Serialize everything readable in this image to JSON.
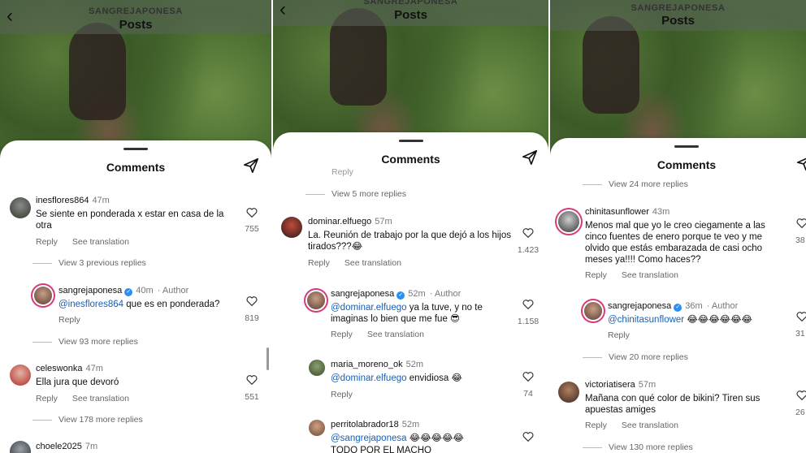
{
  "header": {
    "username": "SANGREJAPONESA",
    "title": "Posts"
  },
  "sheet_title": "Comments",
  "p1": {
    "c1": {
      "user": "inesflores864",
      "time": "47m",
      "text": "Se siente en ponderada x estar en casa de la otra",
      "reply": "Reply",
      "translate": "See translation",
      "likes": "755",
      "more": "View 3 previous replies"
    },
    "c2": {
      "user": "sangrejaponesa",
      "time": "40m",
      "author": "· Author",
      "mention": "@inesflores864",
      "text": " que es en ponderada?",
      "reply": "Reply",
      "likes": "819",
      "more": "View 93 more replies"
    },
    "c3": {
      "user": "celeswonka",
      "time": "47m",
      "text": "Ella jura que devoró",
      "reply": "Reply",
      "translate": "See translation",
      "likes": "551",
      "more": "View 178 more replies"
    },
    "c4": {
      "user": "choele2025",
      "time": "7m"
    }
  },
  "p2": {
    "top_reply": "Reply",
    "more_top": "View 5 more replies",
    "c1": {
      "user": "dominar.elfuego",
      "time": "57m",
      "text": "La. Reunión de trabajo por la que dejó a los hijos tirados???😂",
      "reply": "Reply",
      "translate": "See translation",
      "likes": "1.423"
    },
    "c2": {
      "user": "sangrejaponesa",
      "time": "52m",
      "author": "· Author",
      "mention": "@dominar.elfuego",
      "text": " ya la tuve, y no te imaginas lo bien que me fue 😎",
      "reply": "Reply",
      "translate": "See translation",
      "likes": "1.158"
    },
    "c3": {
      "user": "maria_moreno_ok",
      "time": "52m",
      "mention": "@dominar.elfuego",
      "text": " envidiosa 😂",
      "reply": "Reply",
      "likes": "74"
    },
    "c4": {
      "user": "perritolabrador18",
      "time": "52m",
      "mention": "@sangrejaponesa",
      "text": " 😂😂😂😂😂",
      "text2": "TODO POR EL MACHO"
    }
  },
  "p3": {
    "more_top": "View 24 more replies",
    "c1": {
      "user": "chinitasunflower",
      "time": "43m",
      "text": "Menos mal que yo le creo ciegamente a las cinco fuentes de enero porque te veo y me olvido que estás embarazada de casi ocho meses ya!!!! Como haces??",
      "reply": "Reply",
      "translate": "See translation",
      "likes": "38"
    },
    "c2": {
      "user": "sangrejaponesa",
      "time": "36m",
      "author": "· Author",
      "mention": "@chinitasunflower",
      "text": " 😂😂😂😂😂😂",
      "reply": "Reply",
      "likes": "31",
      "more": "View 20 more replies"
    },
    "c3": {
      "user": "victoriatisera",
      "time": "57m",
      "text": "Mañana con qué color de bikini? Tiren sus apuestas amiges",
      "reply": "Reply",
      "translate": "See translation",
      "likes": "26",
      "more": "View 130 more replies"
    }
  },
  "colors": {
    "mention": "#1a5fb4",
    "verified": "#2a8ff5",
    "story_ring": "#d63a7a"
  },
  "icons": [
    "back-icon",
    "send-icon",
    "heart-icon",
    "verified-icon"
  ]
}
